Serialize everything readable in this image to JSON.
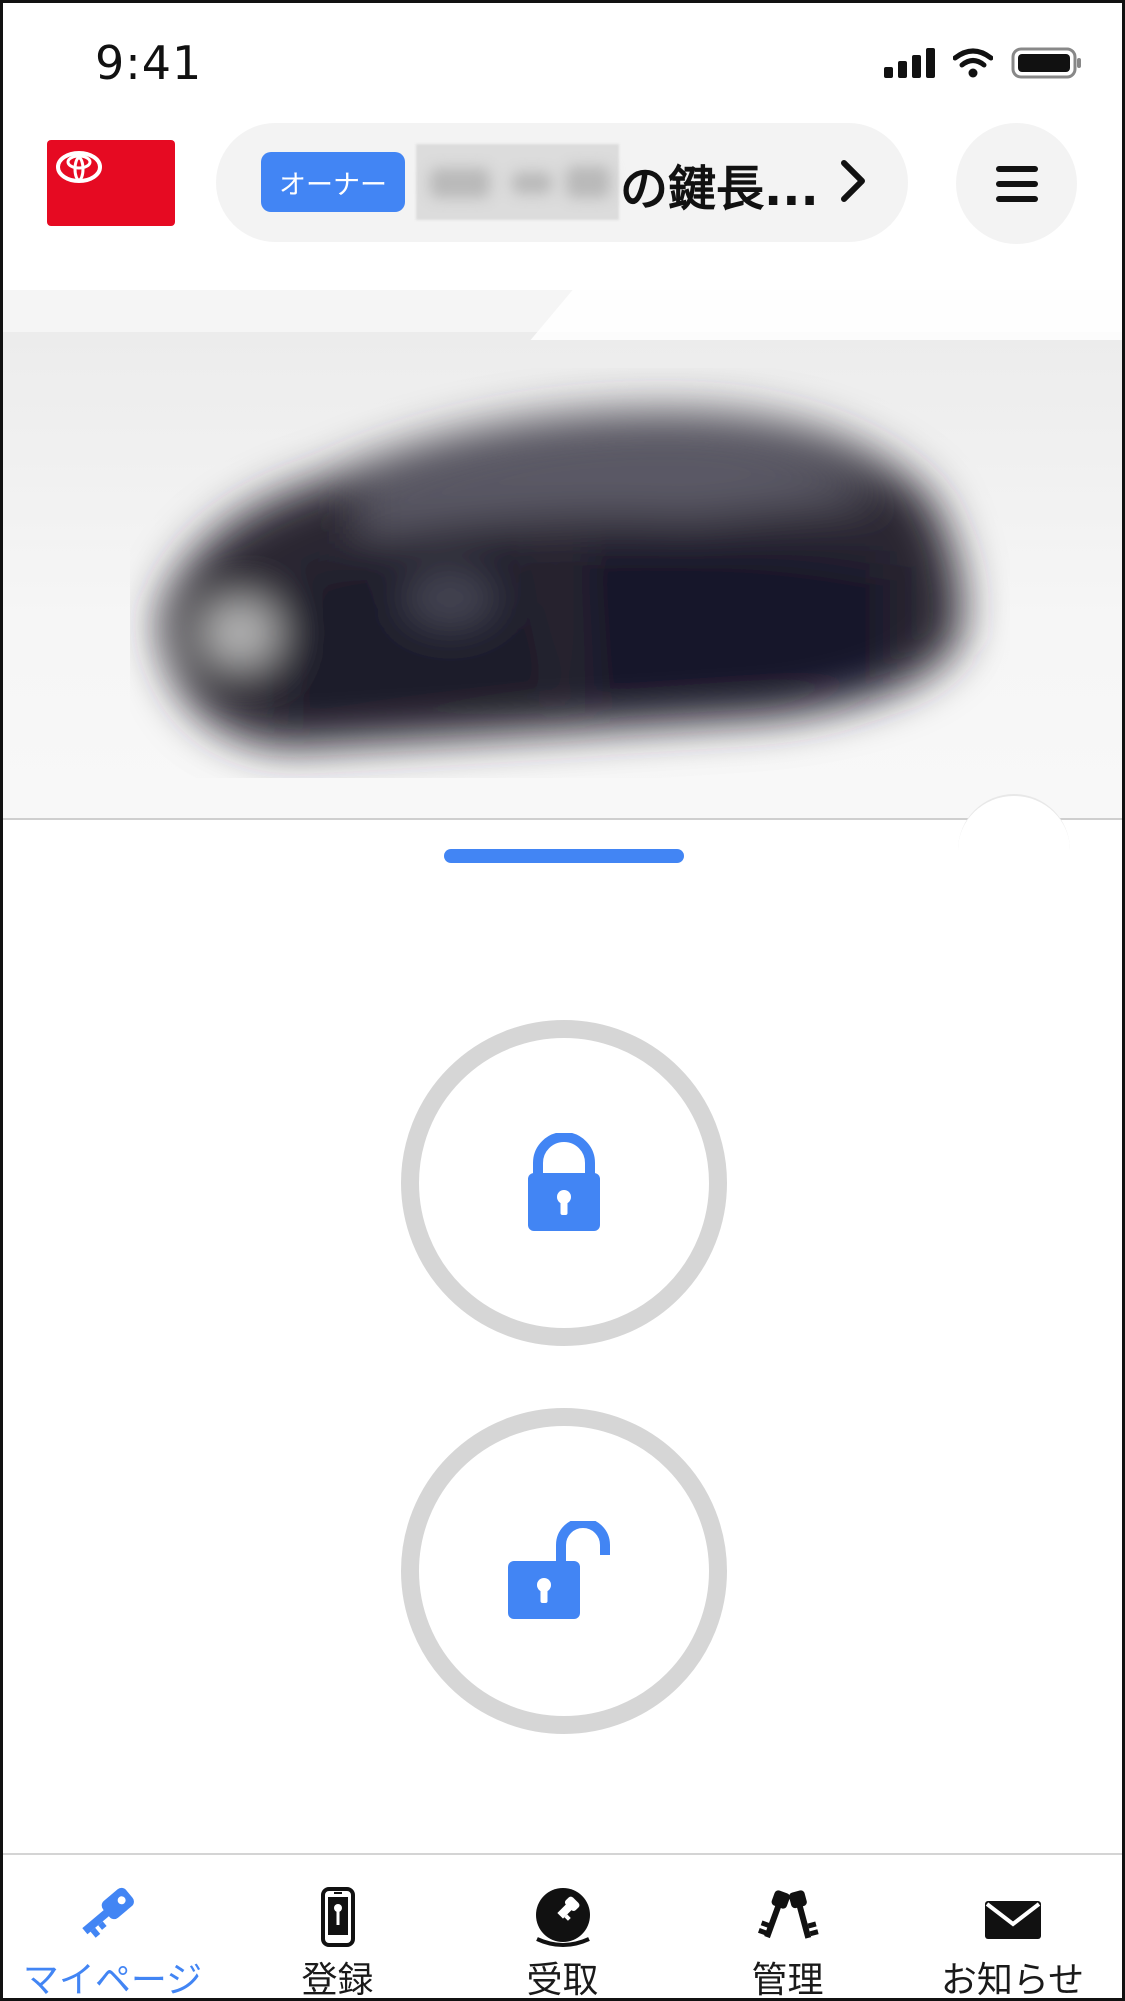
{
  "status_bar": {
    "time": "9:41"
  },
  "header": {
    "owner_badge": "オーナー",
    "vehicle_label": "の鍵長..."
  },
  "tabs": [
    {
      "label": "マイページ",
      "icon": "key-icon",
      "active": true
    },
    {
      "label": "登録",
      "icon": "phone-key-icon",
      "active": false
    },
    {
      "label": "受取",
      "icon": "receive-key-icon",
      "active": false
    },
    {
      "label": "管理",
      "icon": "keys-icon",
      "active": false
    },
    {
      "label": "お知らせ",
      "icon": "mail-icon",
      "active": false
    }
  ],
  "colors": {
    "accent": "#4285f4",
    "brand": "#e60a22",
    "ring": "#d6d6d6"
  }
}
